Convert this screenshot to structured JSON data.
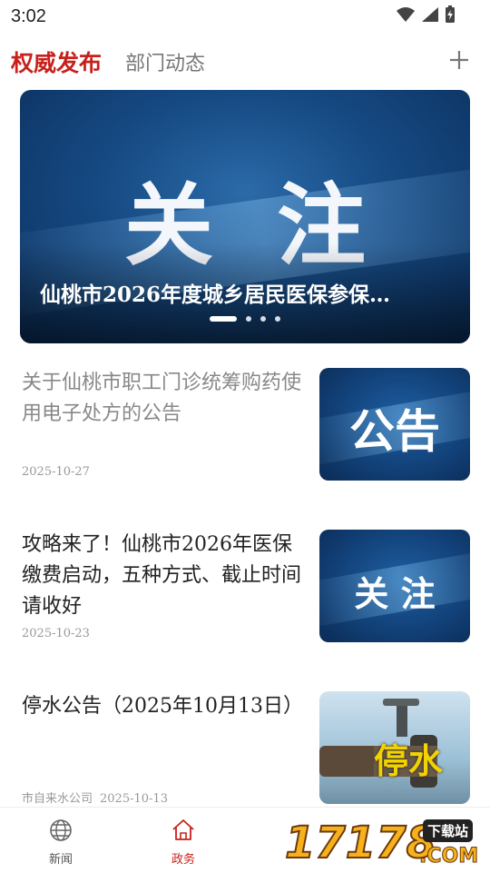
{
  "status_bar": {
    "time": "3:02"
  },
  "tabs": {
    "active": "权威发布",
    "inactive": "部门动态"
  },
  "banner": {
    "headline": "关注",
    "caption": "仙桃市2026年度城乡居民医保参保…",
    "slides_total": 4,
    "active_slide": 1
  },
  "news": [
    {
      "title": "关于仙桃市职工门诊统筹购药使用电子处方的公告",
      "source": "",
      "date": "2025-10-27",
      "read": true,
      "thumb_text": "公告"
    },
    {
      "title": "攻略来了！仙桃市2026年医保缴费启动，五种方式、截止时间请收好",
      "source": "",
      "date": "2025-10-23",
      "read": false,
      "thumb_text": "关 注"
    },
    {
      "title": "停水公告（2025年10月13日）",
      "source": "市自来水公司",
      "date": "2025-10-13",
      "read": false,
      "thumb_text": "停水"
    }
  ],
  "bottom_nav": [
    {
      "label": "新闻",
      "icon": "globe-icon",
      "active": false
    },
    {
      "label": "政务",
      "icon": "home-icon",
      "active": true
    }
  ],
  "colors": {
    "accent": "#c8201b",
    "inactive": "#555555"
  },
  "watermark": {
    "text": "17178",
    "badge": "下载站",
    "suffix": ".COM"
  }
}
